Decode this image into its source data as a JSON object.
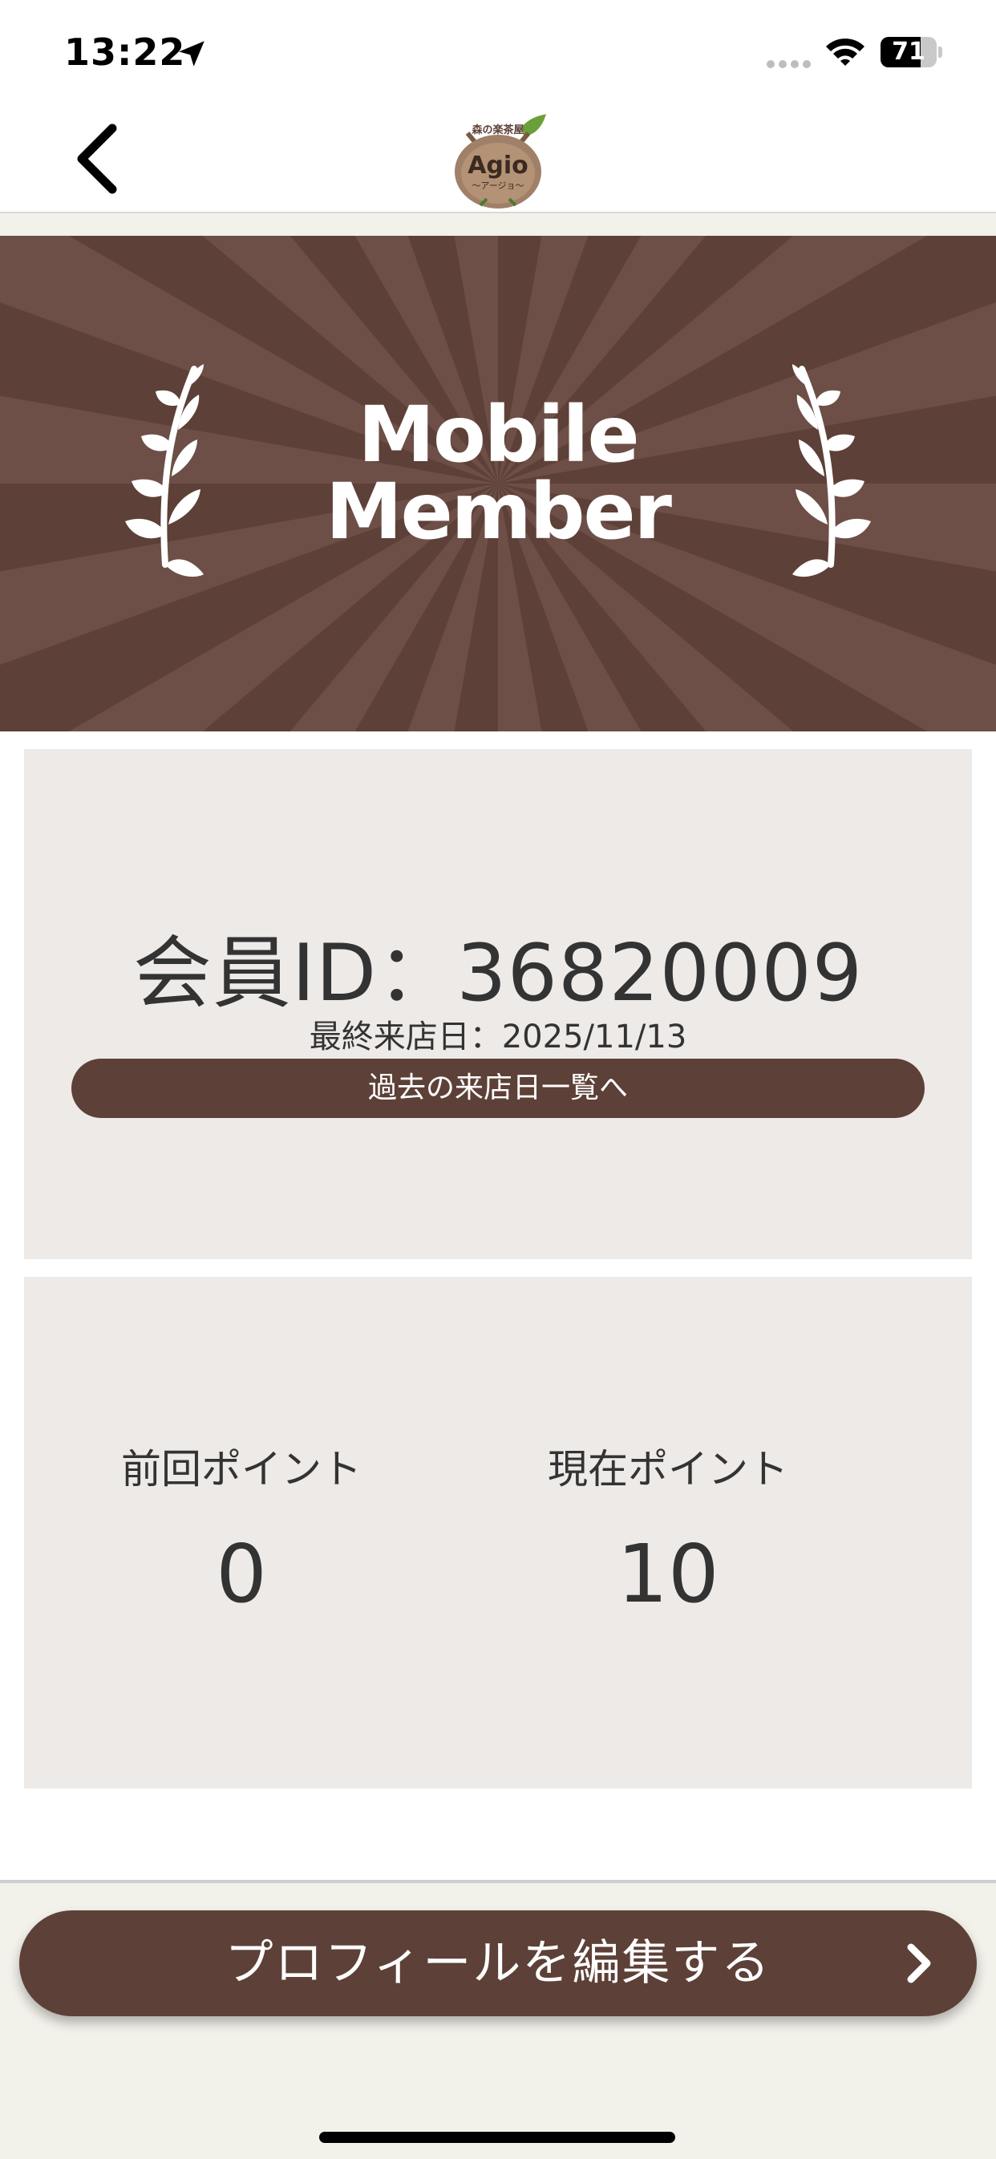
{
  "status_bar": {
    "time": "13:22",
    "battery": "71",
    "battery_level": 0.71,
    "icons": [
      "location-arrow-icon",
      "signal-icon",
      "wifi-icon",
      "battery-icon"
    ]
  },
  "nav": {
    "back_icon": "chevron-left-icon",
    "logo": {
      "top_text": "森の楽茶屋",
      "main_text": "Agio",
      "sub_text": "〜アージョ〜"
    }
  },
  "banner": {
    "title_line1": "Mobile",
    "title_line2": "Member",
    "icons": [
      "laurel-left-icon",
      "laurel-right-icon"
    ]
  },
  "member": {
    "id_text": "会員ID：36820009",
    "last_visit": "最終来店日：2025/11/13",
    "history_button": "過去の来店日一覧へ"
  },
  "points": {
    "previous_label": "前回ポイント",
    "previous_value": "0",
    "current_label": "現在ポイント",
    "current_value": "10"
  },
  "footer": {
    "edit_profile_button": "プロフィールを編集する",
    "chevron_icon": "chevron-right-icon"
  },
  "colors": {
    "brand_brown": "#5d4037",
    "card_bg": "#edeae8",
    "text": "#333333",
    "footer_bg": "#f2f1ea"
  }
}
